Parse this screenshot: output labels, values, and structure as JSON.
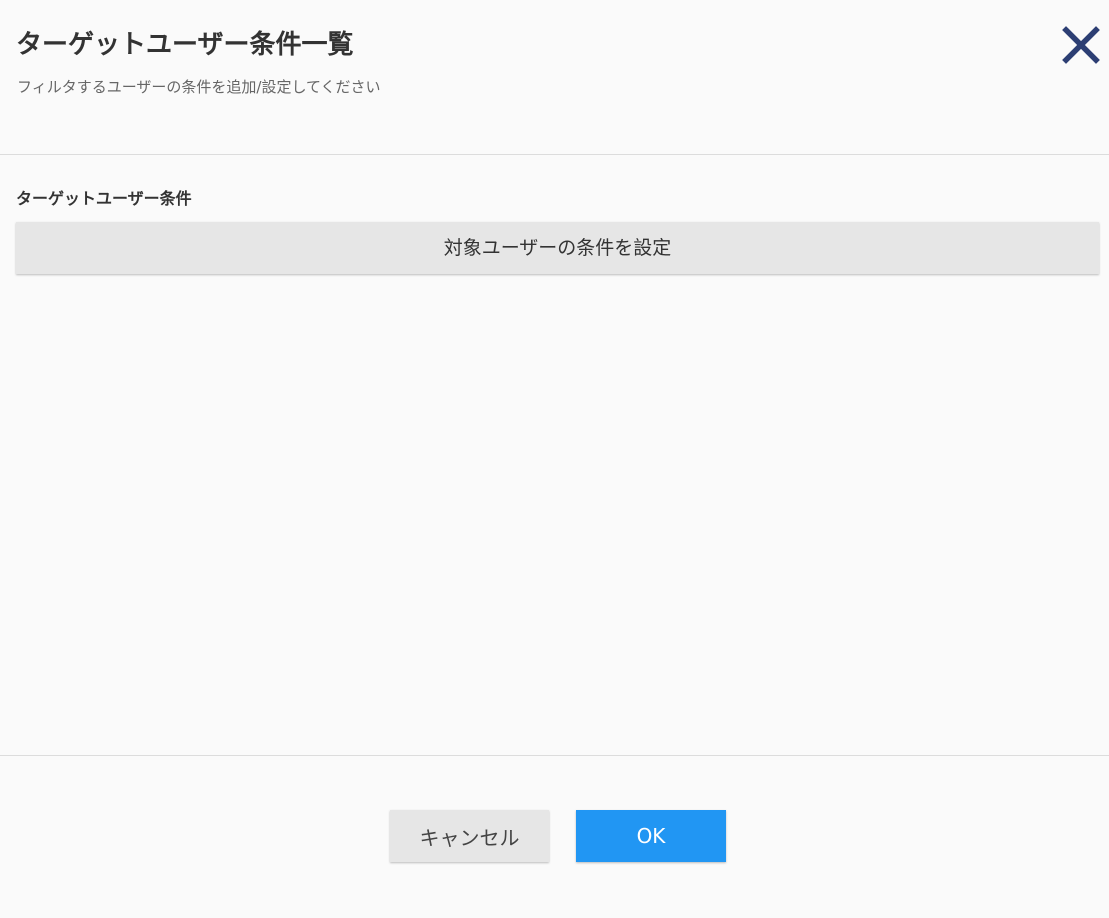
{
  "dialog": {
    "title": "ターゲットユーザー条件一覧",
    "subtitle": "フィルタするユーザーの条件を追加/設定してください",
    "close_icon": "close-icon"
  },
  "section": {
    "label": "ターゲットユーザー条件",
    "set_condition_button": "対象ユーザーの条件を設定"
  },
  "footer": {
    "cancel_label": "キャンセル",
    "ok_label": "OK"
  },
  "colors": {
    "background": "#fafafa",
    "close_icon": "#2c3e73",
    "primary_button": "#2196f3",
    "secondary_button": "#e6e6e6",
    "divider": "#dcdcdc"
  }
}
